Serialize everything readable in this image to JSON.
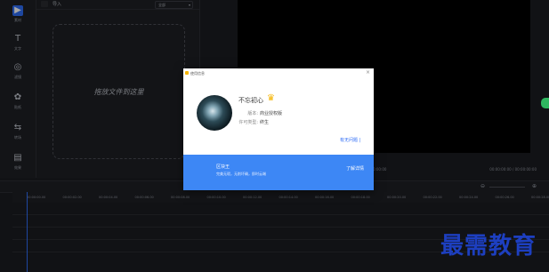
{
  "rail": {
    "items": [
      {
        "label": "素材",
        "icon": "media-icon"
      },
      {
        "label": "文字",
        "icon": "text-icon"
      },
      {
        "label": "滤镜",
        "icon": "filter-icon"
      },
      {
        "label": "贴纸",
        "icon": "sticker-icon"
      },
      {
        "label": "转场",
        "icon": "transition-icon"
      },
      {
        "label": "效果",
        "icon": "effect-icon"
      }
    ]
  },
  "media": {
    "import_label": "导入",
    "select_value": "全部",
    "drop_text": "拖放文件到这里"
  },
  "preview": {
    "time_left": "00:00:00:00",
    "time_right": "00:00:00:00 / 00:00:00:00"
  },
  "timeline": {
    "ticks": [
      "00:00:00.00",
      "00:00:02.00",
      "00:00:04.00",
      "00:00:06.00",
      "00:00:08.00",
      "00:00:10.00",
      "00:00:12.00",
      "00:00:14.00",
      "00:00:16.00",
      "00:00:18.00",
      "00:00:20.00",
      "00:00:22.00",
      "00:00:24.00",
      "00:00:26.00",
      "00:00:28.00"
    ]
  },
  "modal": {
    "title": "使用信息",
    "close": "×",
    "username": "不忘初心",
    "version_label": "版本:",
    "version_value": "商业授权版",
    "license_label": "许可类型:",
    "license_value": "终生",
    "help_link": "有无问题 |",
    "feature_title": "区块王",
    "feature_desc": "完美无瑕，无削坏确，即时云端",
    "feature_link": "了解详情"
  },
  "watermark": "最需教育",
  "colors": {
    "accent": "#2f6df6",
    "footer": "#3d87f5",
    "crown": "#f5b400"
  }
}
